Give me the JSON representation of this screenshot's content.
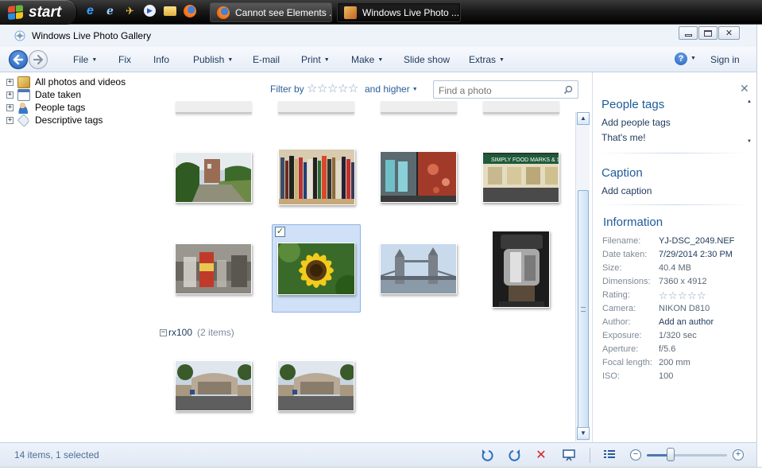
{
  "taskbar": {
    "start_label": "start",
    "quicklaunch": [
      "ie-icon",
      "ie-alt-icon",
      "plane-icon",
      "media-icon",
      "folder-icon",
      "firefox-icon"
    ],
    "tasks": [
      {
        "label": "Cannot see Elements ...",
        "icon": "firefox-icon"
      },
      {
        "label": "Windows Live Photo ...",
        "icon": "photo-gallery-icon"
      }
    ]
  },
  "window": {
    "title": "Windows Live Photo Gallery"
  },
  "toolbar": {
    "menus": [
      "File",
      "Fix",
      "Info",
      "Publish",
      "E-mail",
      "Print",
      "Make",
      "Slide show",
      "Extras"
    ],
    "help": "?",
    "signin": "Sign in"
  },
  "navtree": {
    "items": [
      "All photos and videos",
      "Date taken",
      "People tags",
      "Descriptive tags"
    ]
  },
  "filter": {
    "label": "Filter by",
    "and_higher": "and higher",
    "search_placeholder": "Find a photo"
  },
  "gallery": {
    "group_toggle": "−",
    "group_name": "rx100",
    "group_count": "(2 items)",
    "selected_checkmark": "✓"
  },
  "info_pane": {
    "people_tags": {
      "heading": "People tags",
      "add": "Add people tags",
      "me": "That's me!"
    },
    "caption": {
      "heading": "Caption",
      "add": "Add caption"
    },
    "information": {
      "heading": "Information",
      "rows": [
        {
          "key": "Filename:",
          "value": "YJ-DSC_2049.NEF"
        },
        {
          "key": "Date taken:",
          "value": "7/29/2014  2:30 PM"
        },
        {
          "key": "Size:",
          "value": "40.4 MB"
        },
        {
          "key": "Dimensions:",
          "value": "7360 x 4912"
        },
        {
          "key": "Rating:",
          "value": ""
        },
        {
          "key": "Camera:",
          "value": "NIKON D810"
        },
        {
          "key": "Author:",
          "value": "Add an author"
        },
        {
          "key": "Exposure:",
          "value": "1/320 sec"
        },
        {
          "key": "Aperture:",
          "value": "f/5.6"
        },
        {
          "key": "Focal length:",
          "value": "200 mm"
        },
        {
          "key": "ISO:",
          "value": "100"
        }
      ]
    }
  },
  "status": {
    "text": "14 items, 1 selected",
    "zoom_level": 0.3
  },
  "colors": {
    "accent": "#1e5a9a",
    "selection": "#cfe0f7"
  }
}
